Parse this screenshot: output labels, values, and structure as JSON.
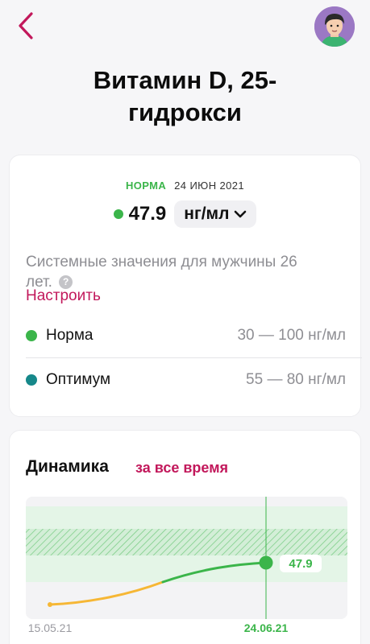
{
  "page": {
    "title": "Витамин D, 25-гидрокси",
    "title_line1": "Витамин D, 25-",
    "title_line2": "гидрокси"
  },
  "result": {
    "status": "НОРМА",
    "date": "24 ИЮН 2021",
    "value": "47.9",
    "unit": "нг/мл",
    "status_color": "#3bb54a"
  },
  "reference": {
    "system_text_line1": "Системные значения для мужчины 26",
    "system_text_line2": "лет.",
    "help_icon": "?",
    "setup_link": "Настроить",
    "ranges": [
      {
        "label": "Норма",
        "range": "30 — 100 нг/мл",
        "color": "#3bb54a"
      },
      {
        "label": "Оптимум",
        "range": "55 — 80 нг/мл",
        "color": "#16888a"
      }
    ]
  },
  "dynamics": {
    "title": "Динамика",
    "period_link": "за все время"
  },
  "chart_data": {
    "type": "line",
    "x": [
      "15.05.21",
      "24.06.21"
    ],
    "series": [
      {
        "values": [
          null,
          47.9
        ]
      }
    ],
    "point_label": "47.9",
    "tick_labels": [
      "15.05.21",
      "24.06.21"
    ],
    "bands": [
      {
        "range": [
          30,
          100
        ],
        "color": "#e6f5e8"
      },
      {
        "range": [
          55,
          80
        ],
        "color": "#3bb54a",
        "hatched": true
      }
    ],
    "line_colors": [
      "#f6b735",
      "#3bb54a"
    ],
    "grid": false
  },
  "colors": {
    "accent": "#c2185b",
    "norm": "#3bb54a",
    "optimum": "#16888a"
  }
}
